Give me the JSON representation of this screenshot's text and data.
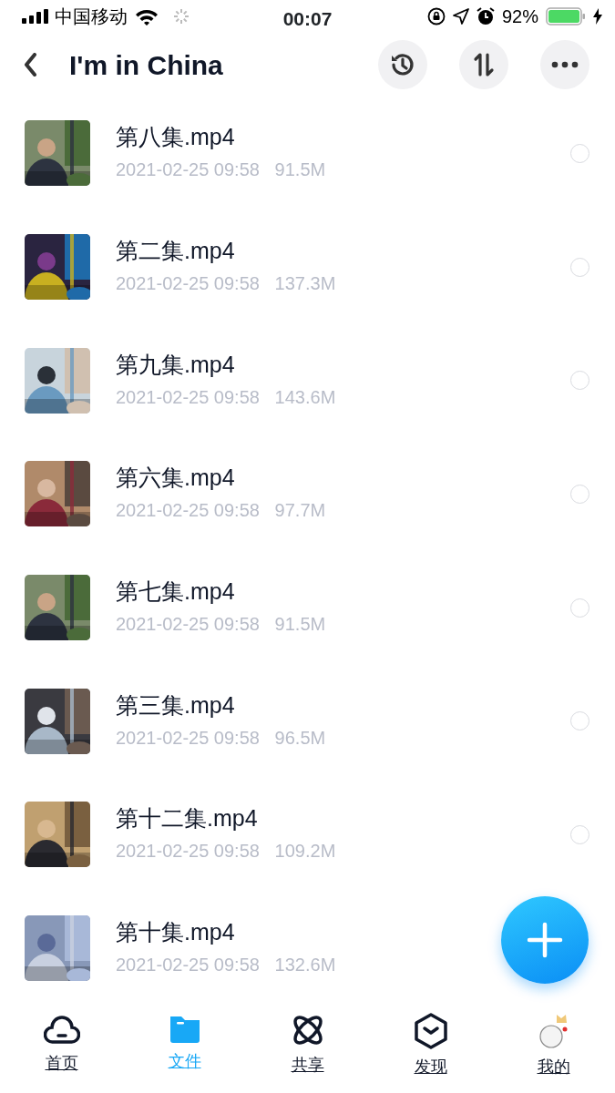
{
  "status_bar": {
    "carrier": "中国移动",
    "time": "00:07",
    "battery": "92%"
  },
  "header": {
    "title": "I'm in China"
  },
  "files": [
    {
      "name": "第八集.mp4",
      "date": "2021-02-25 09:58",
      "size": "91.5M",
      "selected": false
    },
    {
      "name": "第二集.mp4",
      "date": "2021-02-25 09:58",
      "size": "137.3M",
      "selected": false
    },
    {
      "name": "第九集.mp4",
      "date": "2021-02-25 09:58",
      "size": "143.6M",
      "selected": false
    },
    {
      "name": "第六集.mp4",
      "date": "2021-02-25 09:58",
      "size": "97.7M",
      "selected": false
    },
    {
      "name": "第七集.mp4",
      "date": "2021-02-25 09:58",
      "size": "91.5M",
      "selected": false
    },
    {
      "name": "第三集.mp4",
      "date": "2021-02-25 09:58",
      "size": "96.5M",
      "selected": false
    },
    {
      "name": "第十二集.mp4",
      "date": "2021-02-25 09:58",
      "size": "109.2M",
      "selected": false
    },
    {
      "name": "第十集.mp4",
      "date": "2021-02-25 09:58",
      "size": "132.6M"
    }
  ],
  "tab_bar": [
    {
      "label": "首页",
      "kind": "home",
      "selected": false
    },
    {
      "label": "文件",
      "kind": "files",
      "selected": true
    },
    {
      "label": "共享",
      "kind": "share",
      "selected": false
    },
    {
      "label": "发现",
      "kind": "discover",
      "selected": false
    },
    {
      "label": "我的",
      "kind": "me",
      "selected": false
    }
  ]
}
